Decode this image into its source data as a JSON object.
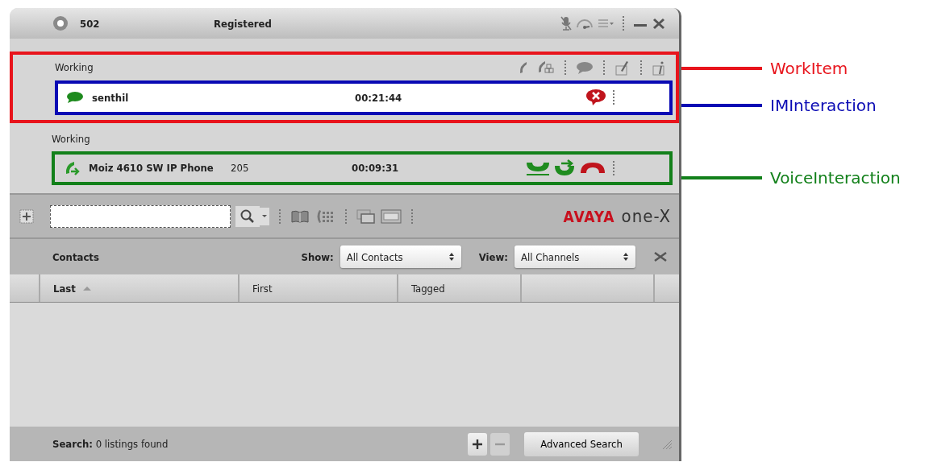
{
  "title_bar": {
    "extension": "502",
    "status": "Registered"
  },
  "work_items": [
    {
      "state": "Working",
      "actions_shown": true,
      "callout": {
        "label": "WorkItem",
        "color": "#e8141c"
      },
      "interaction": {
        "kind": "im",
        "name": "senthil",
        "time": "00:21:44",
        "callout": {
          "label": "IMInteraction",
          "color": "#0a0ab4"
        }
      }
    },
    {
      "state": "Working",
      "actions_shown": false,
      "interaction": {
        "kind": "voice",
        "name": "Moiz 4610 SW IP Phone",
        "number": "205",
        "time": "00:09:31",
        "callout": {
          "label": "VoiceInteraction",
          "color": "#12801a"
        }
      }
    }
  ],
  "logo": {
    "brand": "AVAYA",
    "product": "one-X"
  },
  "contacts": {
    "title": "Contacts",
    "show_label": "Show:",
    "show_value": "All Contacts",
    "view_label": "View:",
    "view_value": "All Channels",
    "columns": [
      {
        "label": "Last",
        "sorted": true
      },
      {
        "label": "First",
        "sorted": false
      },
      {
        "label": "Tagged",
        "sorted": false
      }
    ],
    "status": "**Search:** 0 listings found",
    "advanced_button": "Advanced Search"
  }
}
